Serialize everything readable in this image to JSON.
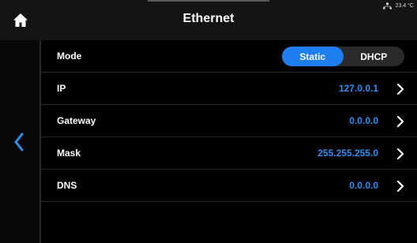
{
  "header": {
    "title": "Ethernet",
    "temperature": "23.4 °C",
    "home_icon": "home-icon",
    "network_icon": "network-status-icon"
  },
  "nav": {
    "back_icon": "chevron-left-icon"
  },
  "mode": {
    "label": "Mode",
    "options": [
      "Static",
      "DHCP"
    ],
    "selected": "Static"
  },
  "rows": [
    {
      "label": "IP",
      "value": "127.0.0.1"
    },
    {
      "label": "Gateway",
      "value": "0.0.0.0"
    },
    {
      "label": "Mask",
      "value": "255.255.255.0"
    },
    {
      "label": "DNS",
      "value": "0.0.0.0"
    }
  ],
  "colors": {
    "accent": "#1f7ff0",
    "value_text": "#2f8ff0",
    "header_bg": "#141414",
    "background": "#000000"
  }
}
